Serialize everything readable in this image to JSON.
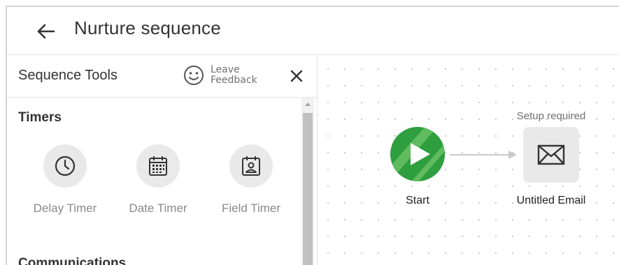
{
  "header": {
    "title": "Nurture sequence",
    "back_icon": "arrow-left-icon"
  },
  "sidebar": {
    "title": "Sequence Tools",
    "feedback_label": "Leave\nFeedback",
    "feedback_icon": "smiley-icon",
    "close_icon": "close-icon",
    "sections": [
      {
        "title": "Timers",
        "tools": [
          {
            "label": "Delay Timer",
            "icon": "clock-icon"
          },
          {
            "label": "Date Timer",
            "icon": "calendar-grid-icon"
          },
          {
            "label": "Field Timer",
            "icon": "calendar-person-icon"
          }
        ]
      },
      {
        "title": "Communications",
        "tools": []
      }
    ]
  },
  "canvas": {
    "start_node": {
      "label": "Start",
      "icon": "play-icon",
      "color": "#2e9e3e"
    },
    "email_node": {
      "label": "Untitled Email",
      "status": "Setup required",
      "icon": "envelope-icon"
    }
  }
}
